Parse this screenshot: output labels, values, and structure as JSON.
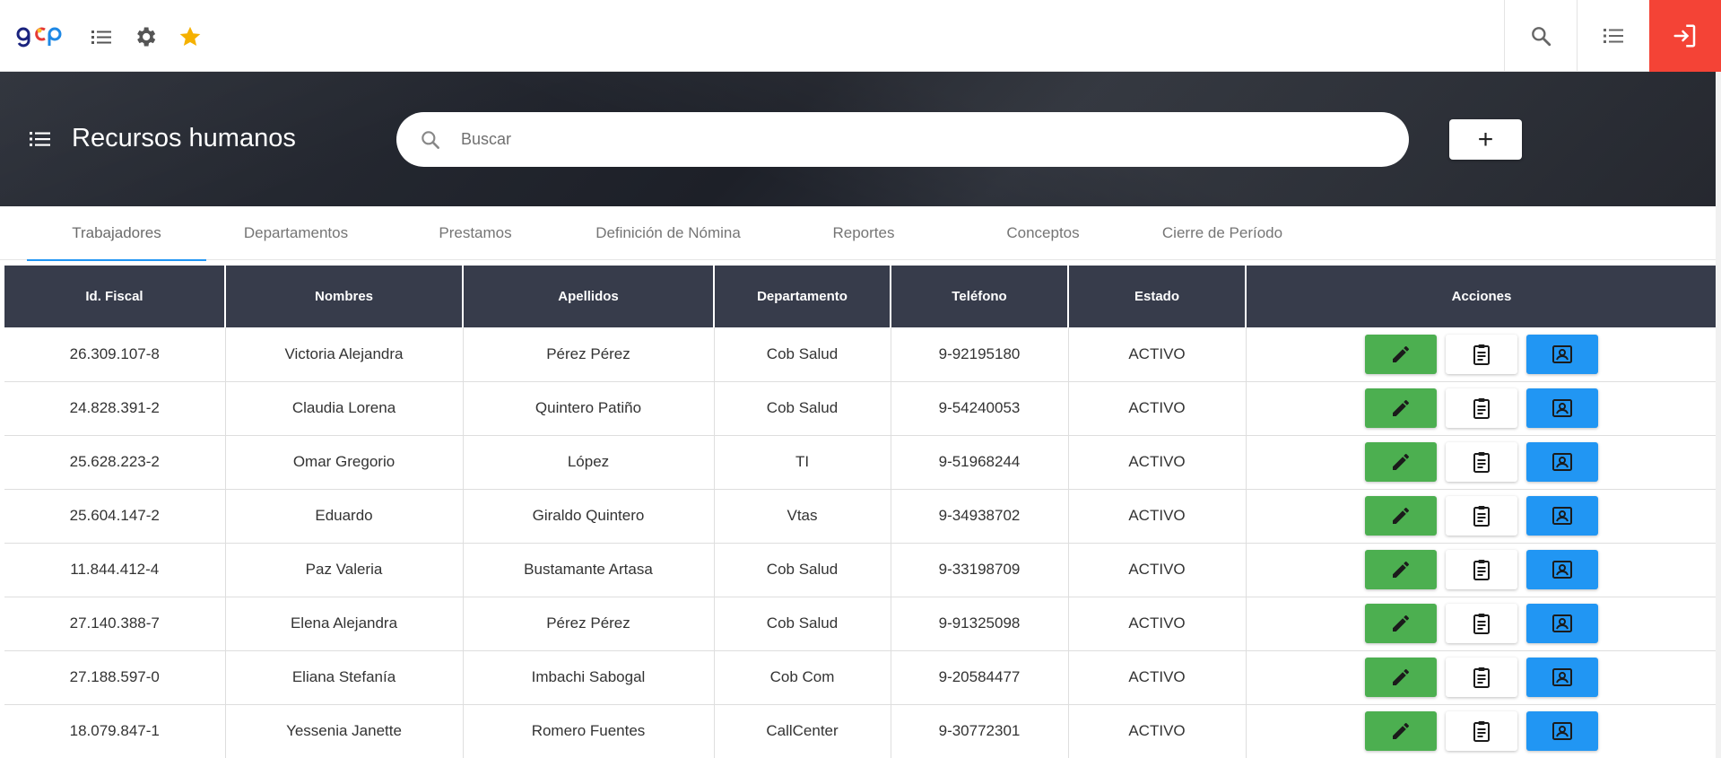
{
  "topbar": {
    "logo_text": "gcp",
    "icons": [
      "list-icon",
      "gear-icon",
      "star-icon"
    ],
    "right_icons": [
      "search-icon",
      "checklist-icon",
      "logout-icon"
    ],
    "colors": {
      "star": "#f5b100",
      "exit": "#f44336"
    }
  },
  "header": {
    "title": "Recursos humanos",
    "search_placeholder": "Buscar",
    "add_label": "+"
  },
  "tabs": [
    {
      "label": "Trabajadores",
      "active": true
    },
    {
      "label": "Departamentos",
      "active": false
    },
    {
      "label": "Prestamos",
      "active": false
    },
    {
      "label": "Definición de Nómina",
      "active": false
    },
    {
      "label": "Reportes",
      "active": false
    },
    {
      "label": "Conceptos",
      "active": false
    },
    {
      "label": "Cierre de Período",
      "active": false
    }
  ],
  "table": {
    "columns": [
      "Id. Fiscal",
      "Nombres",
      "Apellidos",
      "Departamento",
      "Teléfono",
      "Estado",
      "Acciones"
    ],
    "rows": [
      [
        "26.309.107-8",
        "Victoria Alejandra",
        "Pérez Pérez",
        "Cob Salud",
        "9-92195180",
        "ACTIVO"
      ],
      [
        "24.828.391-2",
        "Claudia Lorena",
        "Quintero Patiño",
        "Cob Salud",
        "9-54240053",
        "ACTIVO"
      ],
      [
        "25.628.223-2",
        "Omar Gregorio",
        "López",
        "TI",
        "9-51968244",
        "ACTIVO"
      ],
      [
        "25.604.147-2",
        "Eduardo",
        "Giraldo Quintero",
        "Vtas",
        "9-34938702",
        "ACTIVO"
      ],
      [
        "11.844.412-4",
        "Paz Valeria",
        "Bustamante Artasa",
        "Cob Salud",
        "9-33198709",
        "ACTIVO"
      ],
      [
        "27.140.388-7",
        "Elena Alejandra",
        "Pérez Pérez",
        "Cob Salud",
        "9-91325098",
        "ACTIVO"
      ],
      [
        "27.188.597-0",
        "Eliana Stefanía",
        "Imbachi Sabogal",
        "Cob Com",
        "9-20584477",
        "ACTIVO"
      ],
      [
        "18.079.847-1",
        "Yessenia Janette",
        "Romero Fuentes",
        "CallCenter",
        "9-30772301",
        "ACTIVO"
      ]
    ],
    "action_icons": [
      "pencil-icon",
      "clipboard-icon",
      "contact-card-icon"
    ],
    "action_colors": {
      "edit": "#4caf50",
      "doc": "#ffffff",
      "card": "#2196f3"
    }
  }
}
